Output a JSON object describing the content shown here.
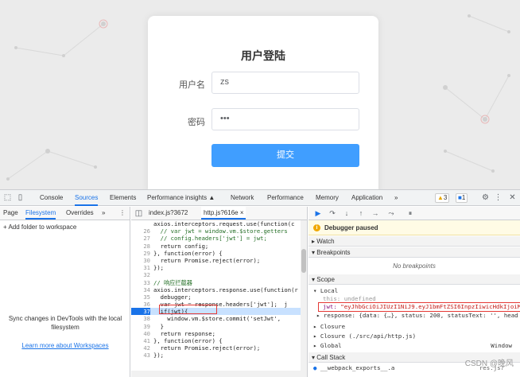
{
  "login": {
    "title": "用户登陆",
    "username_label": "用户名",
    "username_value": "zs",
    "password_label": "密码",
    "password_value": "•••",
    "submit_label": "提交"
  },
  "devtools": {
    "tabs": [
      "Console",
      "Sources",
      "Elements",
      "Performance insights ▲",
      "Network",
      "Performance",
      "Memory",
      "Application",
      "»"
    ],
    "active_tab": "Sources",
    "warning_count": "3",
    "message_count": "1",
    "navigator": {
      "tabs": [
        "Page",
        "Filesystem",
        "Overrides",
        "»"
      ],
      "active_tab": "Filesystem",
      "add_folder": "+ Add folder to workspace",
      "sync_text": "Sync changes in DevTools with the local filesystem",
      "learn_link": "Learn more about Workspaces"
    },
    "editor": {
      "tabs": [
        "index.js?3672",
        "http.js?616e ×"
      ],
      "active_tab": "http.js?616e ×",
      "lines": [
        {
          "n": "",
          "t": "axios.interceptors.request.use(function(c"
        },
        {
          "n": "26",
          "t": "  // var jwt = window.vm.$store.getters",
          "c": true
        },
        {
          "n": "27",
          "t": "  // config.headers['jwt'] = jwt;",
          "c": true
        },
        {
          "n": "28",
          "t": "  return config;"
        },
        {
          "n": "29",
          "t": "}, function(error) {"
        },
        {
          "n": "30",
          "t": "  return Promise.reject(error);"
        },
        {
          "n": "31",
          "t": "});"
        },
        {
          "n": "32",
          "t": ""
        },
        {
          "n": "33",
          "t": "// 响应拦截器",
          "c": true
        },
        {
          "n": "34",
          "t": "axios.interceptors.response.use(function(r"
        },
        {
          "n": "35",
          "t": "  debugger;"
        },
        {
          "n": "36",
          "t": "  var jwt = response.headers['jwt'];  j"
        },
        {
          "n": "37",
          "t": "  if(jwt){",
          "hl": true
        },
        {
          "n": "38",
          "t": "    window.vm.$store.commit('setJwt',"
        },
        {
          "n": "39",
          "t": "  }"
        },
        {
          "n": "40",
          "t": "  return response;"
        },
        {
          "n": "41",
          "t": "}, function(error) {"
        },
        {
          "n": "42",
          "t": "  return Promise.reject(error);"
        },
        {
          "n": "43",
          "t": "});"
        }
      ]
    },
    "debugger": {
      "paused": "Debugger paused",
      "watch": "Watch",
      "breakpoints": "Breakpoints",
      "no_breakpoints": "No breakpoints",
      "scope": "Scope",
      "local": "▾ Local",
      "this_row": "this: undefined",
      "jwt_name": "jwt:",
      "jwt_value": "\"eyJhbGciOiJIUzI1NiJ9.eyJ1bmFtZSI6InpzIiwicHdkIjoiM",
      "response_row": "▸ response: {data: {…}, status: 200, statusText: '', head",
      "closure1": "▸ Closure",
      "closure2": "▸ Closure (./src/api/http.js)",
      "global": "▸ Global",
      "global_value": "Window",
      "call_stack": "Call Stack",
      "frame1": "__webpack_exports__.a",
      "frame1_loc": "res.js?"
    }
  },
  "watermark": "CSDN @晚风"
}
